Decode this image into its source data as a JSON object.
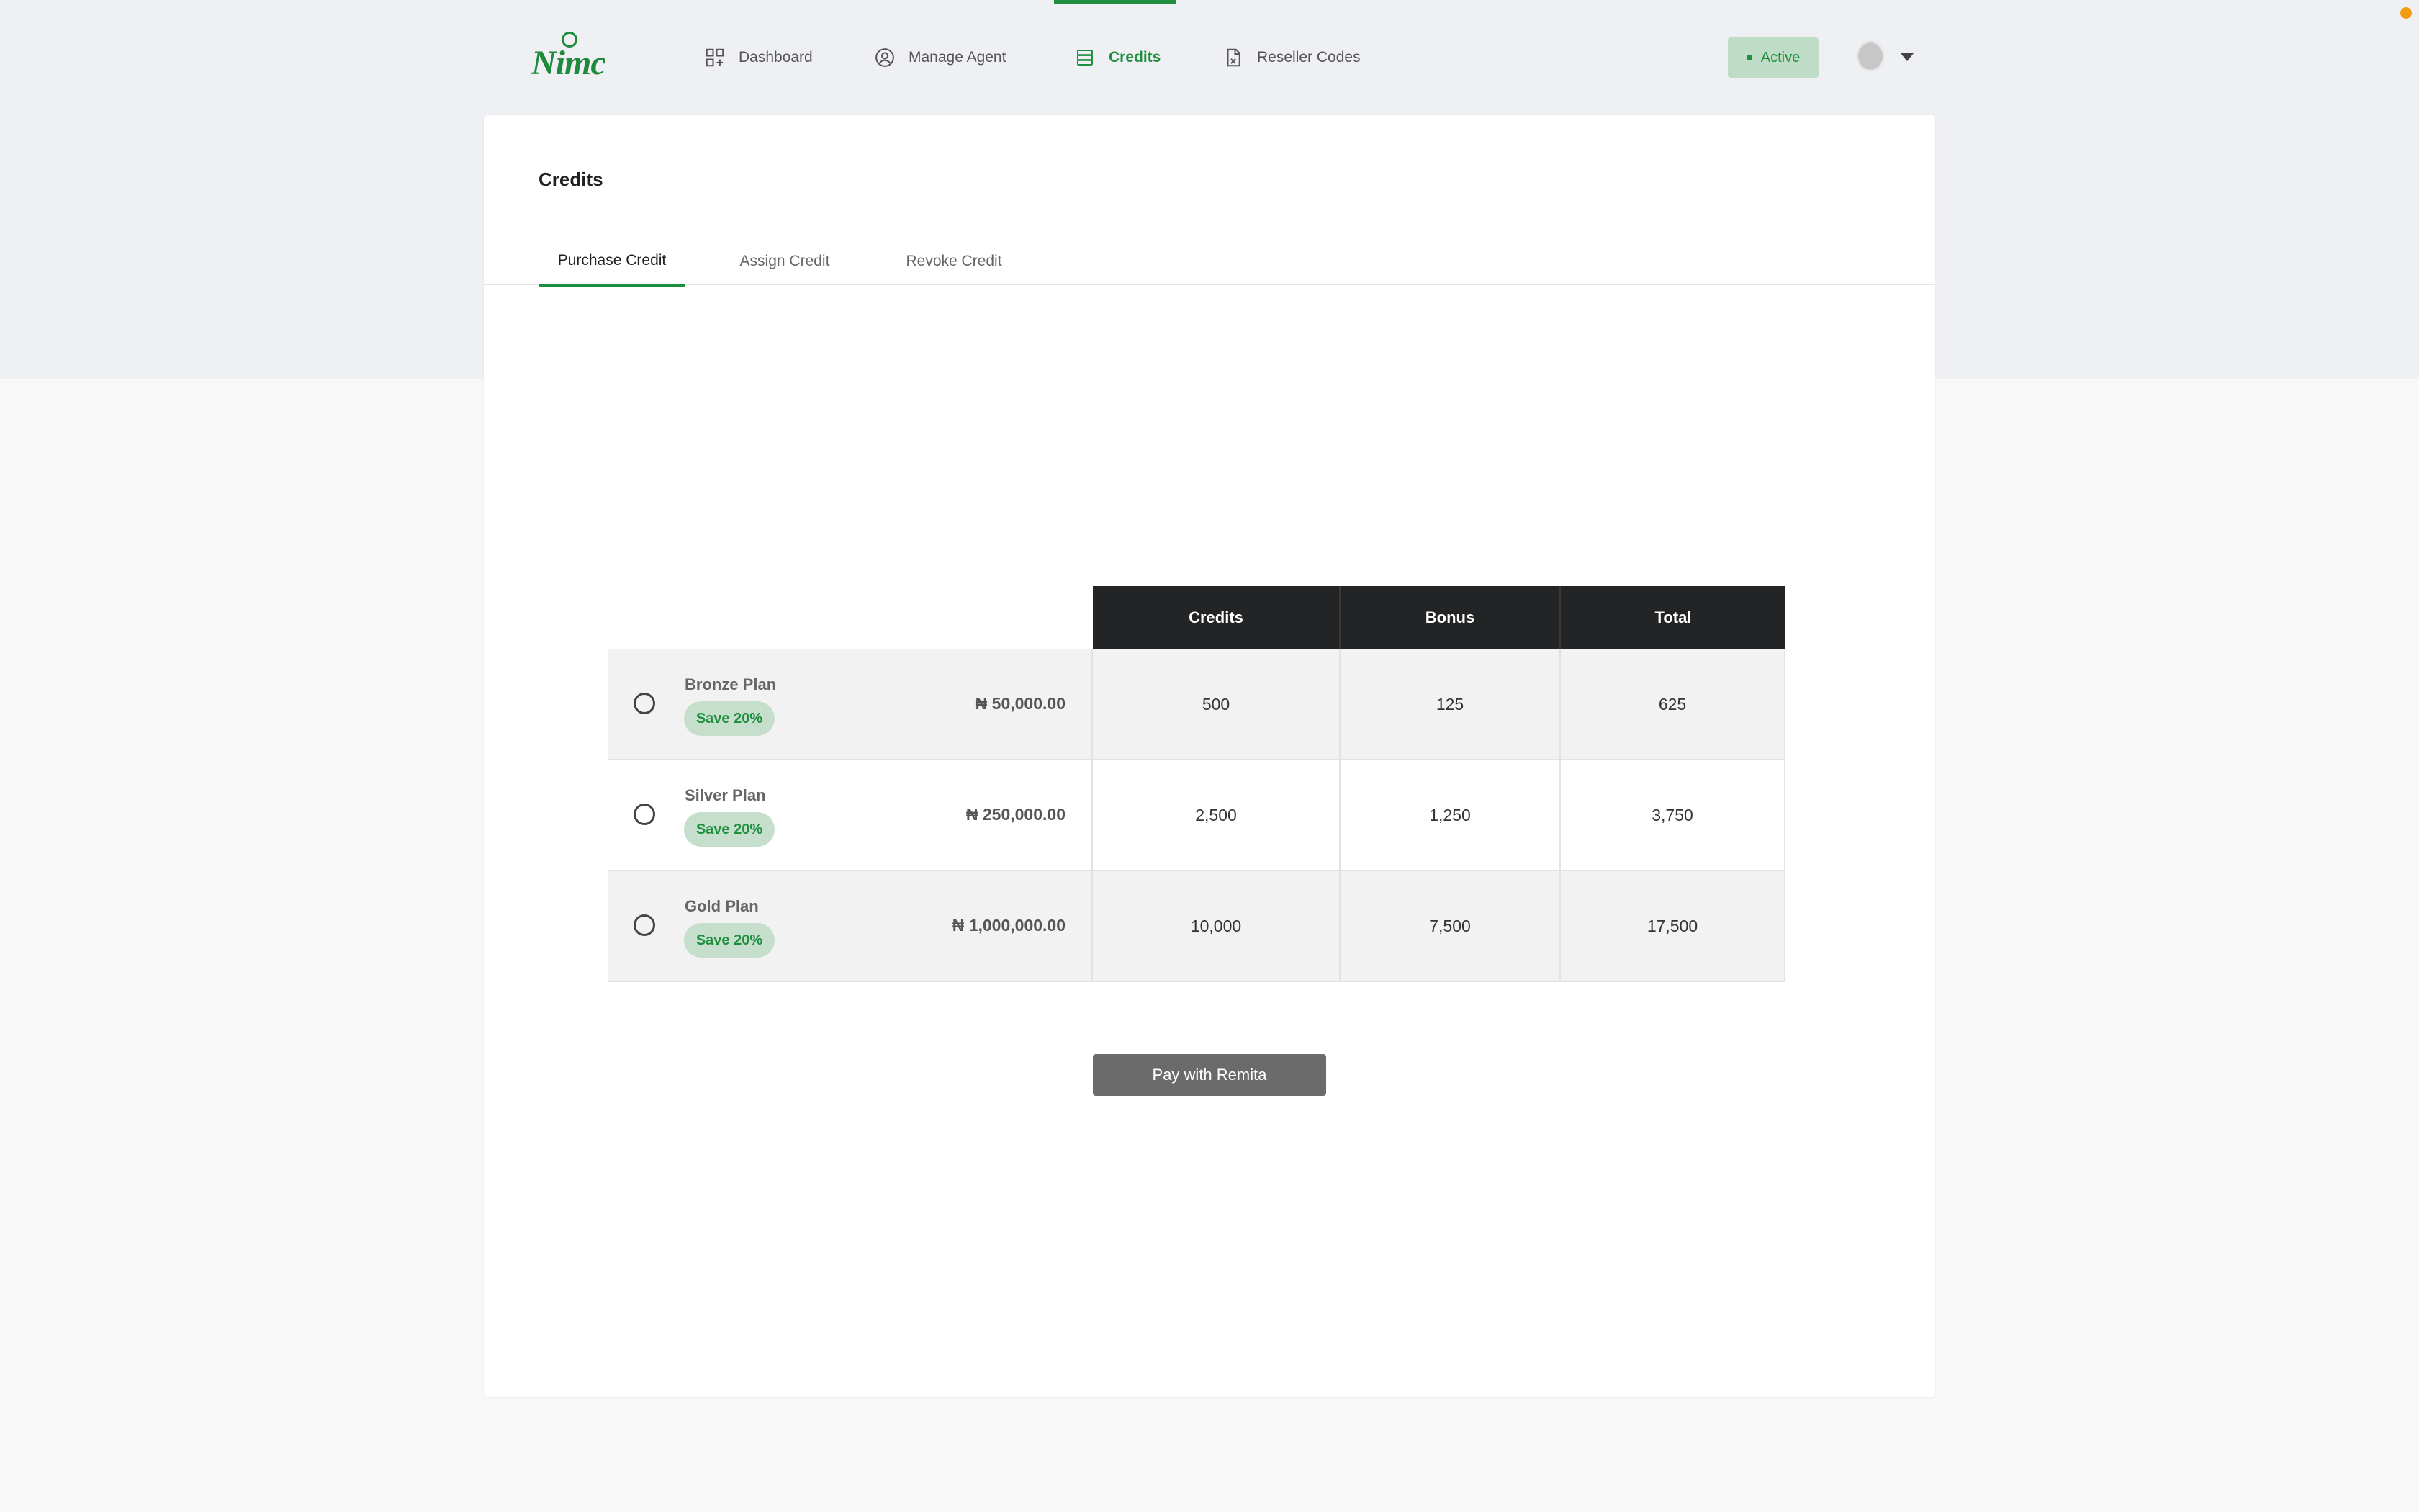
{
  "header": {
    "logo_text": "Nimc",
    "nav": [
      {
        "label": "Dashboard",
        "icon": "dashboard-icon"
      },
      {
        "label": "Manage Agent",
        "icon": "user-circle-icon"
      },
      {
        "label": "Credits",
        "icon": "stack-icon",
        "active": true
      },
      {
        "label": "Reseller Codes",
        "icon": "document-icon"
      }
    ],
    "status": "Active"
  },
  "page": {
    "title": "Credits",
    "tabs": [
      {
        "label": "Purchase Credit",
        "active": true
      },
      {
        "label": "Assign Credit"
      },
      {
        "label": "Revoke Credit"
      }
    ]
  },
  "plans_table": {
    "columns": [
      "Credits",
      "Bonus",
      "Total"
    ],
    "rows": [
      {
        "name": "Bronze Plan",
        "badge": "Save 20%",
        "price": "₦ 50,000.00",
        "credits": "500",
        "bonus": "125",
        "total": "625"
      },
      {
        "name": "Silver Plan",
        "badge": "Save 20%",
        "price": "₦ 250,000.00",
        "credits": "2,500",
        "bonus": "1,250",
        "total": "3,750"
      },
      {
        "name": "Gold Plan",
        "badge": "Save 20%",
        "price": "₦ 1,000,000.00",
        "credits": "10,000",
        "bonus": "7,500",
        "total": "17,500"
      }
    ]
  },
  "pay_button_label": "Pay with Remita",
  "colors": {
    "accent": "#1f8f3f",
    "header_bg": "#222425",
    "button_bg": "#6b6b6b"
  }
}
